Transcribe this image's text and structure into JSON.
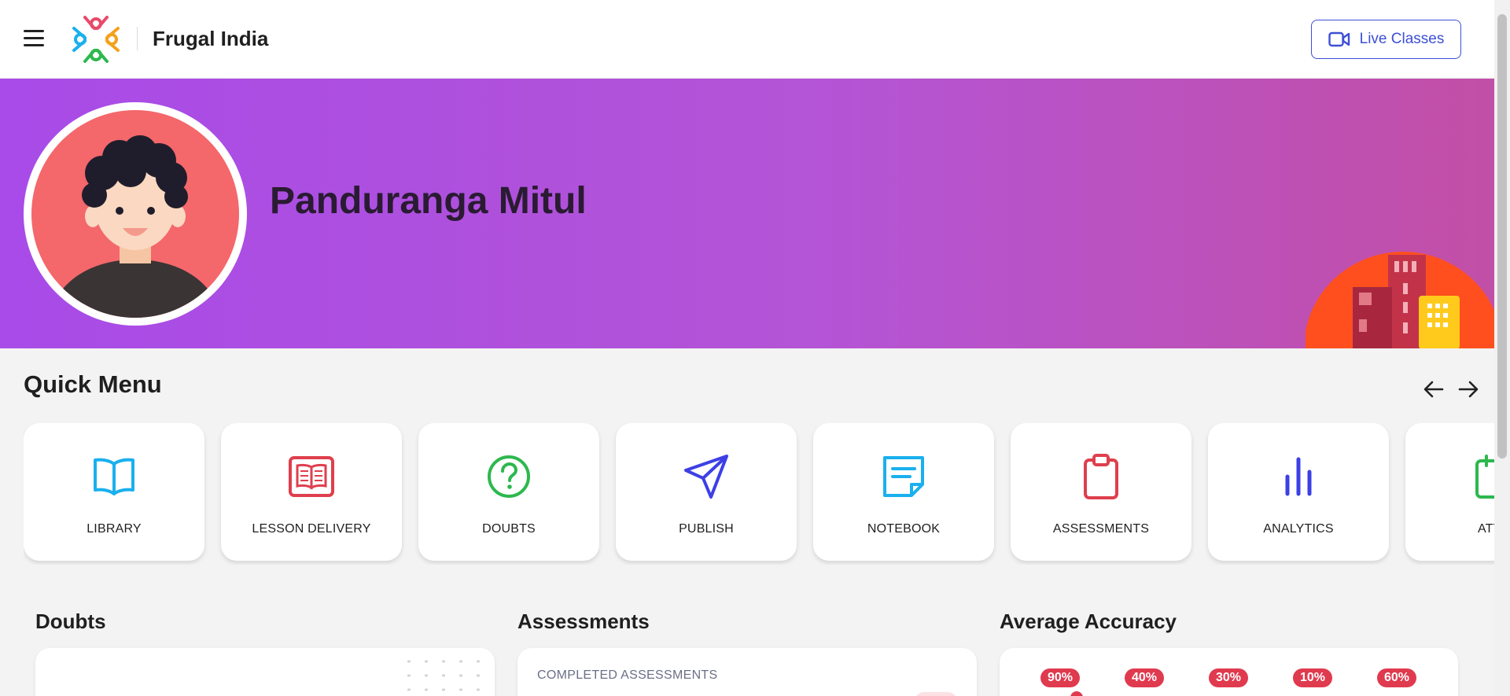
{
  "header": {
    "brand": "Frugal India",
    "live_classes_label": "Live Classes"
  },
  "profile": {
    "name": "Panduranga Mitul"
  },
  "quick_menu": {
    "title": "Quick Menu",
    "items": [
      {
        "label": "LIBRARY",
        "icon": "book-open-icon",
        "color": "#1ab0ee"
      },
      {
        "label": "LESSON DELIVERY",
        "icon": "lesson-book-icon",
        "color": "#df3f4d"
      },
      {
        "label": "DOUBTS",
        "icon": "question-circle-icon",
        "color": "#2db84e"
      },
      {
        "label": "PUBLISH",
        "icon": "paper-plane-icon",
        "color": "#3d3fe6"
      },
      {
        "label": "NOTEBOOK",
        "icon": "notebook-icon",
        "color": "#1ab0ee"
      },
      {
        "label": "ASSESSMENTS",
        "icon": "clipboard-icon",
        "color": "#df3f4d"
      },
      {
        "label": "ANALYTICS",
        "icon": "bar-chart-icon",
        "color": "#3d3fe6"
      },
      {
        "label": "ATTEN",
        "icon": "calendar-icon",
        "color": "#2db84e"
      }
    ]
  },
  "sections": {
    "doubts_title": "Doubts",
    "assessments_title": "Assessments",
    "assessments_sub": "COMPLETED ASSESSMENTS",
    "accuracy_title": "Average Accuracy",
    "accuracy_values": [
      "90%",
      "40%",
      "30%",
      "10%",
      "60%"
    ]
  },
  "colors": {
    "accent": "#3d4fd6",
    "banner_start": "#a84be8",
    "banner_end": "#c24fa6",
    "badge_red": "#e03a4f"
  }
}
